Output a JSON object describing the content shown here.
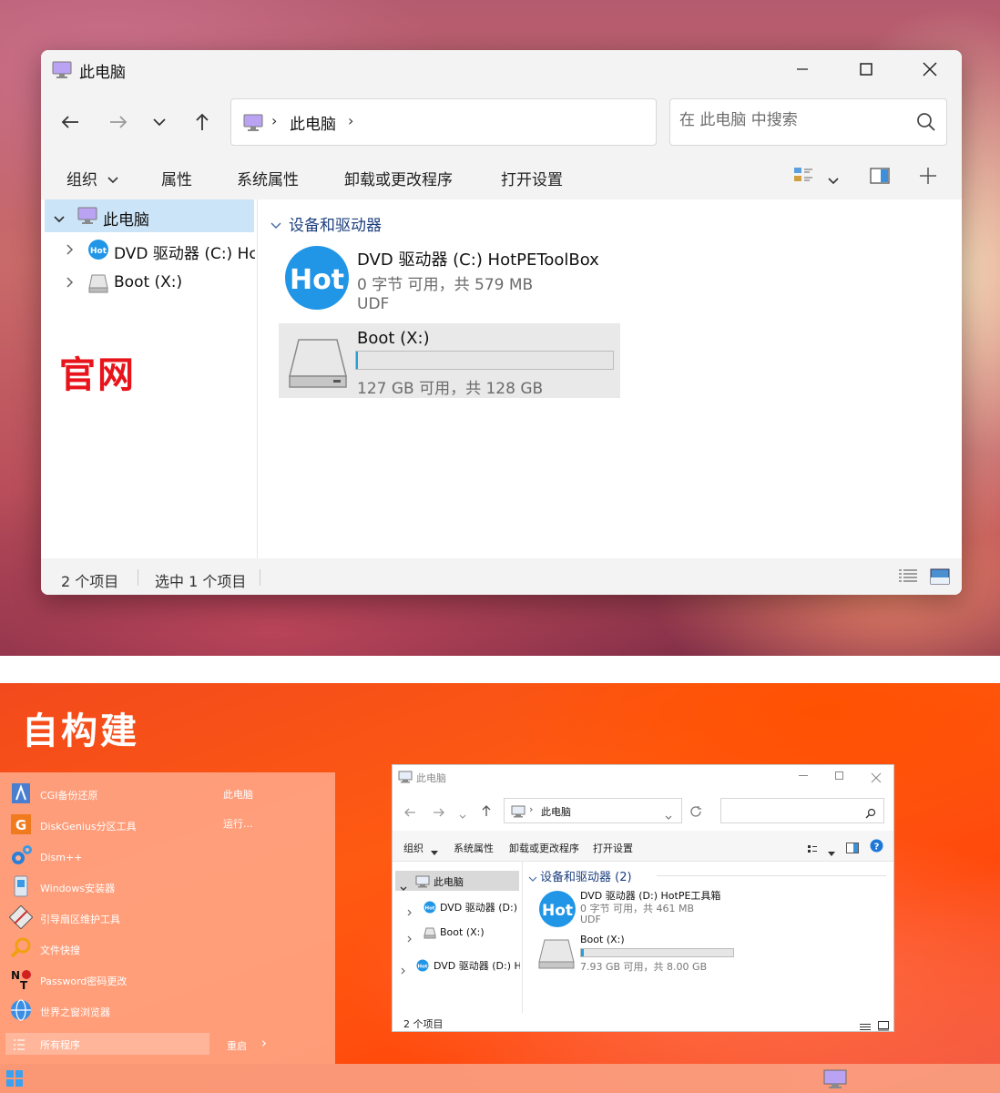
{
  "top": {
    "window_title": "此电脑",
    "nav": {
      "back": "←",
      "forward": "→",
      "recent": "⌄",
      "up": "↑"
    },
    "address": {
      "sep": "›",
      "location": "此电脑",
      "chevron": "›"
    },
    "search_placeholder": "在 此电脑 中搜索",
    "commands": [
      "组织",
      "属性",
      "系统属性",
      "卸载或更改程序",
      "打开设置"
    ],
    "tree": {
      "root": "此电脑",
      "items": [
        "DVD 驱动器 (C:) Hc",
        "Boot (X:)"
      ]
    },
    "watermark_label": "官网",
    "group_title": "设备和驱动器",
    "drives": [
      {
        "name": "DVD 驱动器 (C:) HotPEToolBox",
        "free": "0 字节 可用，共 579 MB",
        "fs": "UDF",
        "icon_text": "Hot"
      },
      {
        "name": "Boot (X:)",
        "free": "127 GB 可用，共 128 GB",
        "used_fraction": 0.0078
      }
    ],
    "status": {
      "count": "2 个项目",
      "selected": "选中 1 个项目"
    }
  },
  "bottom": {
    "label": "自构建",
    "start_menu": {
      "items": [
        "CGI备份还原",
        "DiskGenius分区工具",
        "Dism++",
        "Windows安装器",
        "引导扇区维护工具",
        "文件快搜",
        "Password密码更改",
        "世界之窗浏览器"
      ],
      "right_items": [
        "此电脑",
        "运行..."
      ],
      "all_programs": "所有程序",
      "restart": "重启",
      "restart_arrow": "›"
    },
    "window": {
      "title": "此电脑",
      "address_location": "此电脑",
      "address_sep": "›",
      "commands": [
        "组织",
        "系统属性",
        "卸载或更改程序",
        "打开设置"
      ],
      "tree": [
        "此电脑",
        "DVD 驱动器 (D:) I",
        "Boot (X:)",
        "DVD 驱动器 (D:) H"
      ],
      "group_title": "设备和驱动器 (2)",
      "drives": [
        {
          "name": "DVD 驱动器 (D:) HotPE工具箱",
          "free": "0 字节 可用，共 461 MB",
          "fs": "UDF",
          "icon_text": "Hot"
        },
        {
          "name": "Boot (X:)",
          "free": "7.93 GB 可用，共 8.00 GB",
          "used_fraction": 0.01
        }
      ],
      "status": "2 个项目"
    }
  },
  "colors": {
    "accent": "#1a8bd6",
    "red_label": "#e8141b",
    "selection": "#cce4f7",
    "hot_icon": "#2196e6"
  }
}
